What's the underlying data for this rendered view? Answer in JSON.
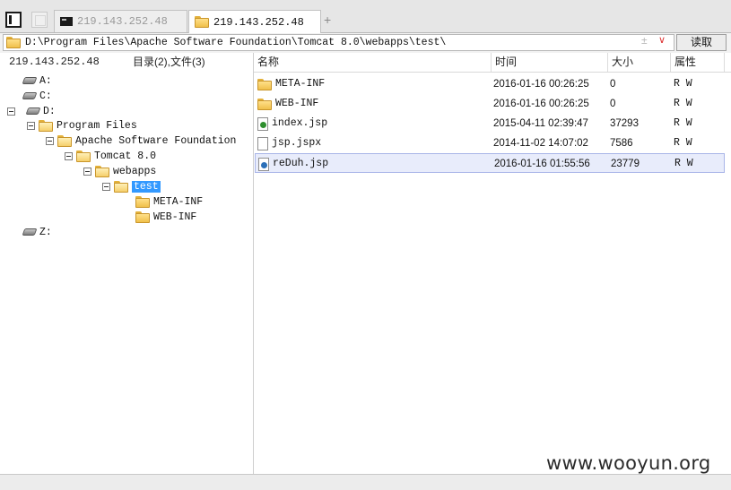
{
  "tabs": [
    {
      "label": "219.143.252.48",
      "icon": "terminal-icon",
      "active": false
    },
    {
      "label": "219.143.252.48",
      "icon": "folder-icon",
      "active": true
    }
  ],
  "add_tab_label": "+",
  "path": {
    "value": "D:\\Program Files\\Apache Software Foundation\\Tomcat 8.0\\webapps\\test\\",
    "star_glyph": "±",
    "dropdown_glyph": "∨",
    "read_button": "读取"
  },
  "left": {
    "host": "219.143.252.48",
    "summary": "目录(2),文件(3)",
    "tree": {
      "drive_a": "A:",
      "drive_c": "C:",
      "drive_d": "D:",
      "program_files": "Program Files",
      "apache": "Apache Software Foundation",
      "tomcat": "Tomcat 8.0",
      "webapps": "webapps",
      "test": "test",
      "meta_inf": "META-INF",
      "web_inf": "WEB-INF",
      "drive_z": "Z:"
    }
  },
  "columns": {
    "name": "名称",
    "time": "时间",
    "size": "大小",
    "attr": "属性"
  },
  "files": [
    {
      "name": "META-INF",
      "time": "2016-01-16 00:26:25",
      "size": "0",
      "attr": "R W",
      "icon": "folder-icon"
    },
    {
      "name": "WEB-INF",
      "time": "2016-01-16 00:26:25",
      "size": "0",
      "attr": "R W",
      "icon": "folder-icon"
    },
    {
      "name": "index.jsp",
      "time": "2015-04-11 02:39:47",
      "size": "37293",
      "attr": "R W",
      "icon": "jsp-file-icon"
    },
    {
      "name": "jsp.jspx",
      "time": "2014-11-02 14:07:02",
      "size": "7586",
      "attr": "R W",
      "icon": "file-icon"
    },
    {
      "name": "reDuh.jsp",
      "time": "2016-01-16 01:55:56",
      "size": "23779",
      "attr": "R W",
      "icon": "jsp-file-icon",
      "selected": true
    }
  ],
  "watermark": "www.wooyun.org"
}
